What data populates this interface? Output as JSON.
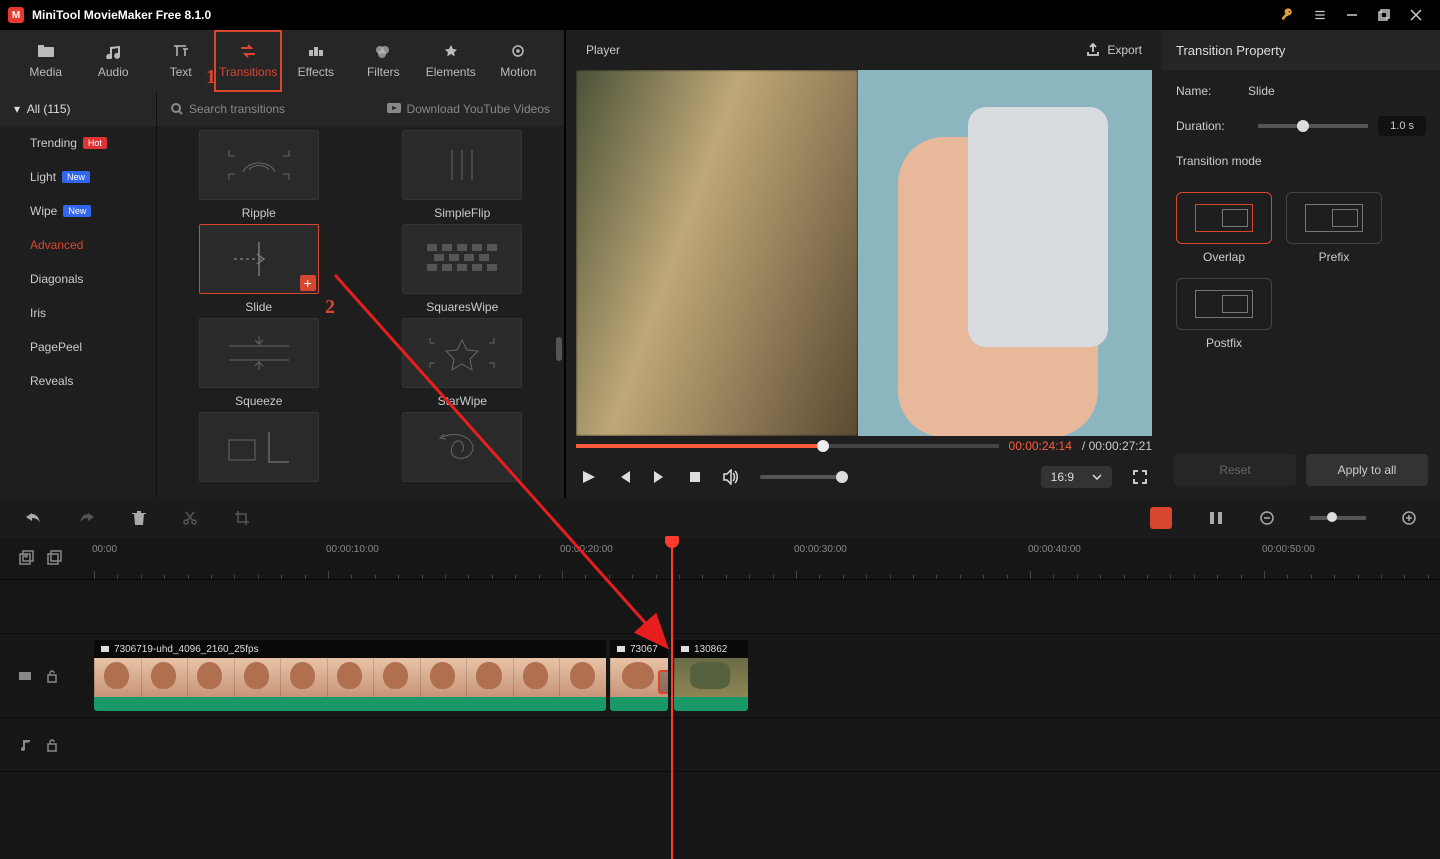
{
  "titlebar": {
    "app": "MiniTool MovieMaker Free 8.1.0"
  },
  "tabs": {
    "media": "Media",
    "audio": "Audio",
    "text": "Text",
    "transitions": "Transitions",
    "effects": "Effects",
    "filters": "Filters",
    "elements": "Elements",
    "motion": "Motion"
  },
  "sidebar": {
    "all": "All (115)",
    "trending": "Trending",
    "light": "Light",
    "wipe": "Wipe",
    "advanced": "Advanced",
    "diagonals": "Diagonals",
    "iris": "Iris",
    "pagepeel": "PagePeel",
    "reveals": "Reveals",
    "hot": "Hot",
    "new": "New"
  },
  "grid": {
    "search_ph": "Search transitions",
    "download": "Download YouTube Videos",
    "ripple": "Ripple",
    "simpleflip": "SimpleFlip",
    "slide": "Slide",
    "squares": "SquaresWipe",
    "squeeze": "Squeeze",
    "starwipe": "StarWipe"
  },
  "player": {
    "title": "Player",
    "export": "Export",
    "cur": "00:00:24:14",
    "sep": " / ",
    "dur": "00:00:27:21",
    "ratio": "16:9"
  },
  "props": {
    "title": "Transition Property",
    "name_l": "Name:",
    "name_v": "Slide",
    "dur_l": "Duration:",
    "dur_v": "1.0 s",
    "mode_l": "Transition mode",
    "overlap": "Overlap",
    "prefix": "Prefix",
    "postfix": "Postfix",
    "reset": "Reset",
    "apply": "Apply to all"
  },
  "timeline": {
    "t0": "00:00",
    "t1": "00:00:10:00",
    "t2": "00:00:20:00",
    "t3": "00:00:30:00",
    "t4": "00:00:40:00",
    "t5": "00:00:50:00",
    "clip1": "7306719-uhd_4096_2160_25fps",
    "clip2": "73067",
    "clip3": "130862"
  },
  "anno": {
    "n1": "1",
    "n2": "2"
  }
}
